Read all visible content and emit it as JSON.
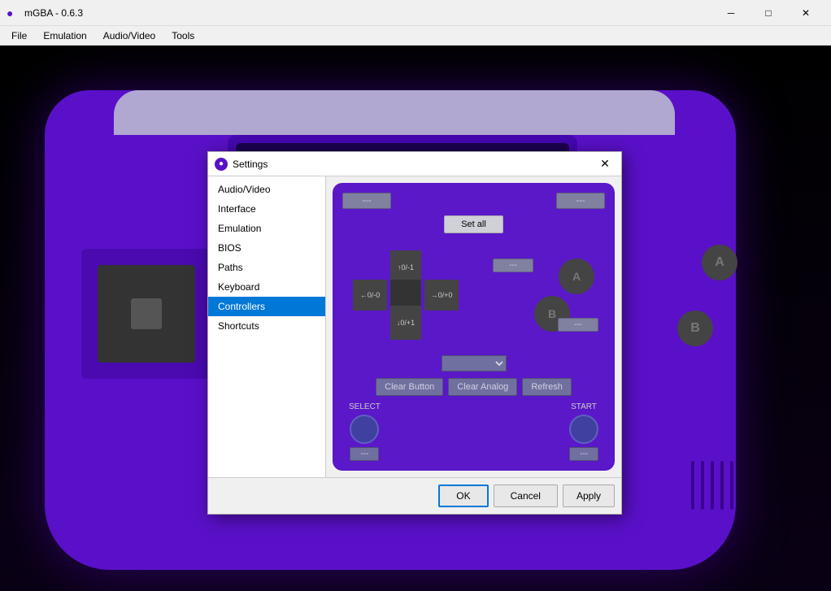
{
  "titlebar": {
    "title": "mGBA - 0.6.3",
    "icon": "●",
    "min_btn": "─",
    "max_btn": "□",
    "close_btn": "✕"
  },
  "menubar": {
    "items": [
      {
        "label": "File"
      },
      {
        "label": "Emulation"
      },
      {
        "label": "Audio/Video"
      },
      {
        "label": "Tools"
      }
    ]
  },
  "dialog": {
    "title": "Settings",
    "close_btn": "✕",
    "sidebar": {
      "items": [
        {
          "label": "Audio/Video",
          "active": false
        },
        {
          "label": "Interface",
          "active": false
        },
        {
          "label": "Emulation",
          "active": false
        },
        {
          "label": "BIOS",
          "active": false
        },
        {
          "label": "Paths",
          "active": false
        },
        {
          "label": "Keyboard",
          "active": false
        },
        {
          "label": "Controllers",
          "active": true
        },
        {
          "label": "Shortcuts",
          "active": false
        }
      ]
    },
    "controller": {
      "top_left_btn": "---",
      "top_right_btn": "---",
      "set_all_btn": "Set all",
      "dpad": {
        "up": "↑0/-1",
        "down": "↓0/+1",
        "left": "←0/-0",
        "right": "→0/+0"
      },
      "btn_a_label": "---",
      "btn_b_label": "---",
      "dropdown_placeholder": "",
      "clear_button_label": "Clear Button",
      "clear_analog_label": "Clear Analog",
      "refresh_label": "Refresh",
      "select_label": "SELECT",
      "start_label": "START",
      "select_btn": "---",
      "start_btn": "---"
    },
    "footer": {
      "ok_label": "OK",
      "cancel_label": "Cancel",
      "apply_label": "Apply"
    }
  }
}
